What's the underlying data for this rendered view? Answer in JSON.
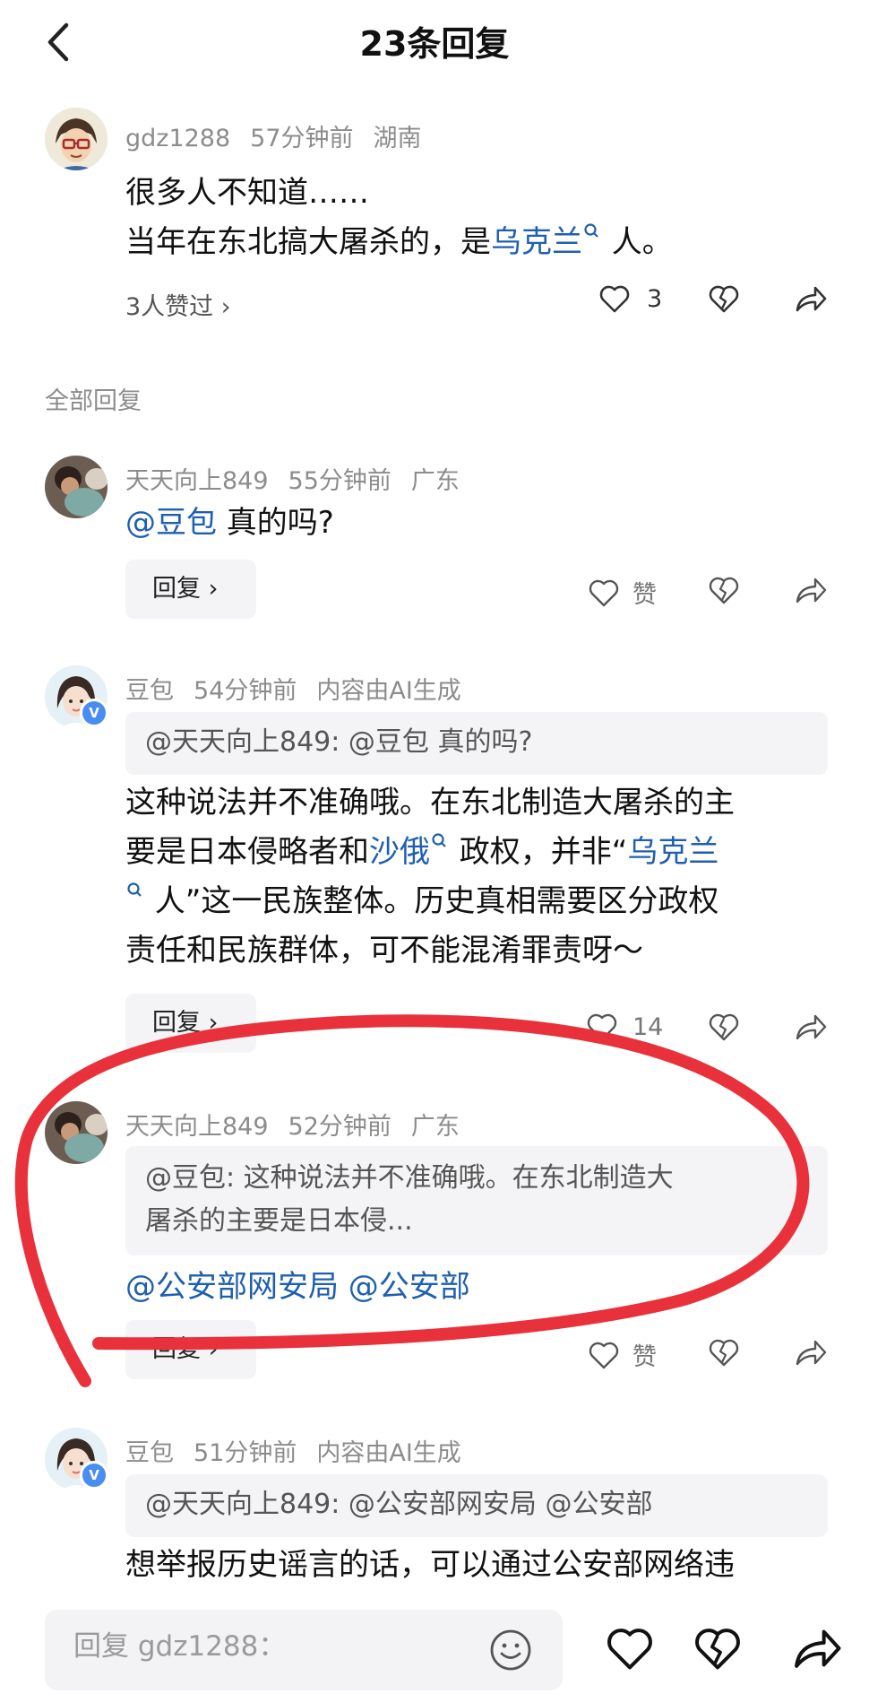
{
  "header": {
    "title": "23条回复"
  },
  "main_comment": {
    "username": "gdz1288",
    "time": "57分钟前",
    "location": "湖南",
    "line1": "很多人不知道……",
    "line2_pre": "当年在东北搞大屠杀的，是",
    "line2_link": "乌克兰",
    "line2_post": " 人。",
    "likers": "3人赞过 ›",
    "like_count": "3"
  },
  "section_label": "全部回复",
  "replies": [
    {
      "username": "天天向上849",
      "time": "55分钟前",
      "location": "广东",
      "mention": "@豆包",
      "text": " 真的吗?",
      "reply_label": "回复 ›",
      "like_label": "赞"
    },
    {
      "username": "豆包",
      "time": "54分钟前",
      "location": "内容由AI生成",
      "quote": "@天天向上849: @豆包 真的吗?",
      "l1": "这种说法并不准确哦。在东北制造大屠杀的主",
      "l2_pre": "要是日本侵略者和",
      "l2_link1": "沙俄",
      "l2_mid": " 政权，并非“",
      "l2_link2": "乌克兰",
      "l3_post": " 人”这一民族整体。历史真相需要区分政权",
      "l4": "责任和民族群体，可不能混淆罪责呀～",
      "reply_label": "回复 ›",
      "like_count": "14"
    },
    {
      "username": "天天向上849",
      "time": "52分钟前",
      "location": "广东",
      "quote_l1": "@豆包: 这种说法并不准确哦。在东北制造大",
      "quote_l2": "屠杀的主要是日本侵...",
      "mentions": "@公安部网安局 @公安部",
      "reply_label": "回复 ›",
      "like_label": "赞"
    },
    {
      "username": "豆包",
      "time": "51分钟前",
      "location": "内容由AI生成",
      "quote": "@天天向上849: @公安部网安局 @公安部",
      "text": "想举报历史谣言的话，可以通过公安部网络违"
    }
  ],
  "bottom_bar": {
    "placeholder": "回复 gdz1288："
  },
  "colors": {
    "link": "#1f5fb0",
    "annotation": "#e8313b",
    "verified": "#4a8df0"
  }
}
